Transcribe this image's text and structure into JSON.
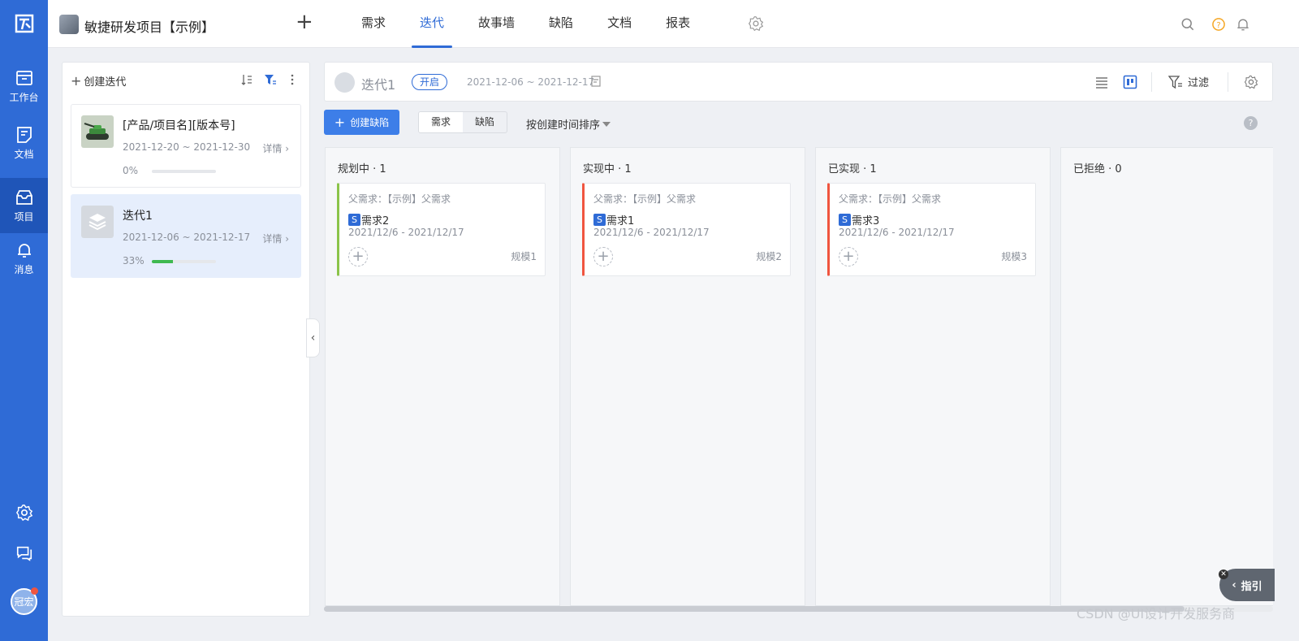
{
  "rail": {
    "items": [
      {
        "label": "工作台",
        "icon": "inbox-tray-icon"
      },
      {
        "label": "文档",
        "icon": "document-icon"
      },
      {
        "label": "项目",
        "icon": "project-box-icon"
      },
      {
        "label": "消息",
        "icon": "bell-icon"
      }
    ],
    "avatar_text": "冠宏"
  },
  "topbar": {
    "project_title": "敏捷研发项目【示例】",
    "tabs": [
      "需求",
      "迭代",
      "故事墙",
      "缺陷",
      "文档",
      "报表"
    ],
    "active_tab": "迭代"
  },
  "sidebar": {
    "create_label": "创建迭代",
    "iterations": [
      {
        "name": "[产品/项目名][版本号]",
        "dates": "2021-12-20 ~ 2021-12-30",
        "detail": "详情",
        "percent_label": "0%",
        "progress": 0
      },
      {
        "name": "迭代1",
        "dates": "2021-12-06 ~ 2021-12-17",
        "detail": "详情",
        "percent_label": "33%",
        "progress": 0.33
      }
    ]
  },
  "header": {
    "title": "迭代1",
    "status": "开启",
    "dates": "2021-12-06 ~ 2021-12-17",
    "filter_label": "过滤"
  },
  "toolbar": {
    "create_label": "创建缺陷",
    "segments": [
      "需求",
      "缺陷"
    ],
    "active_segment": "需求",
    "sort_label": "按创建时间排序"
  },
  "board": {
    "columns": [
      {
        "title": "规划中 · 1",
        "accent": "#8bc34a",
        "cards": [
          {
            "parent": "父需求：【示例】父需求",
            "badge": "S",
            "name": "需求2",
            "dates": "2021/12/6 - 2021/12/17",
            "scale": "规模1"
          }
        ]
      },
      {
        "title": "实现中 · 1",
        "accent": "#f0553f",
        "cards": [
          {
            "parent": "父需求：【示例】父需求",
            "badge": "S",
            "name": "需求1",
            "dates": "2021/12/6 - 2021/12/17",
            "scale": "规模2"
          }
        ]
      },
      {
        "title": "已实现 · 1",
        "accent": "#f0553f",
        "cards": [
          {
            "parent": "父需求：【示例】父需求",
            "badge": "S",
            "name": "需求3",
            "dates": "2021/12/6 - 2021/12/17",
            "scale": "规模3"
          }
        ]
      },
      {
        "title": "已拒绝 · 0",
        "accent": "#cccccc",
        "cards": []
      }
    ]
  },
  "guide": {
    "label": "指引"
  },
  "watermark": "CSDN @UI设计开发服务商",
  "colors": {
    "brand": "#2f6bd6",
    "rail": "#2f6bd6",
    "progress": "#3fb950"
  }
}
